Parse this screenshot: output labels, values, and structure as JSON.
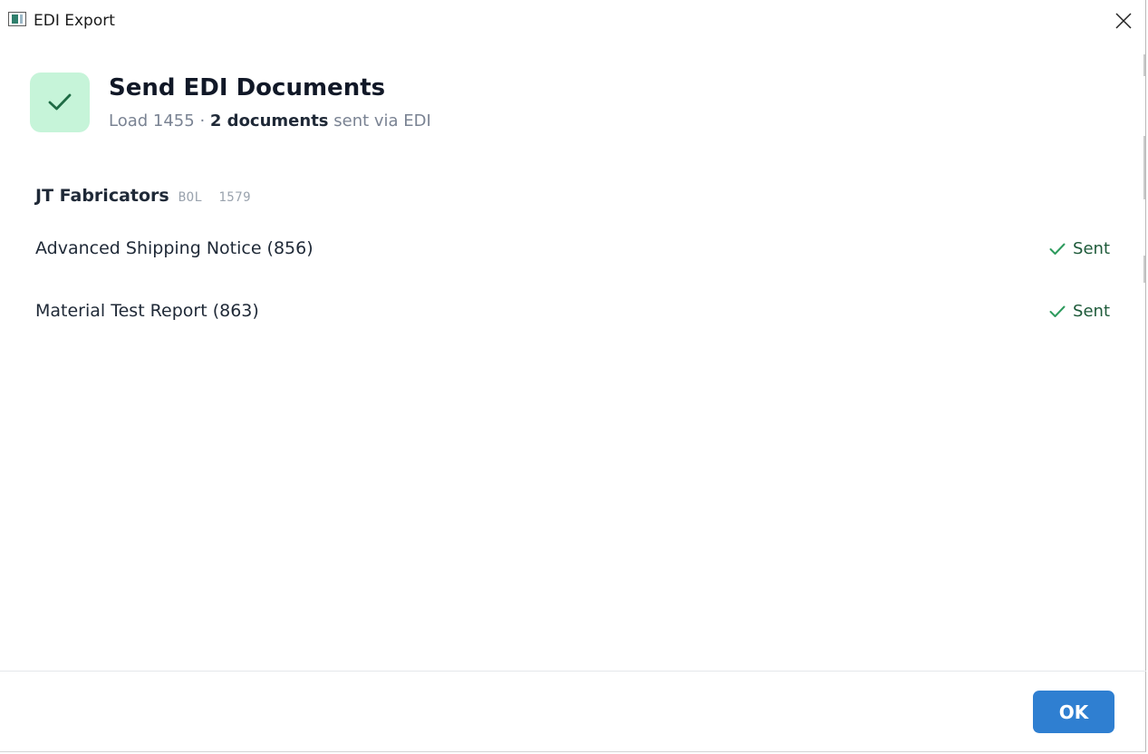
{
  "window": {
    "title": "EDI Export",
    "app_icon": "window-app-icon",
    "close_icon": "close-icon"
  },
  "header": {
    "badge_icon": "checkmark-icon",
    "title": "Send EDI Documents",
    "subtitle": {
      "load": "Load 1455",
      "separator": " · ",
      "count": "2 documents",
      "suffix": " sent via EDI"
    }
  },
  "group": {
    "name": "JT Fabricators",
    "bol": "BOL  1579"
  },
  "documents": [
    {
      "name": "Advanced Shipping Notice (856)",
      "status": "Sent",
      "status_icon": "checkmark-icon"
    },
    {
      "name": "Material Test Report (863)",
      "status": "Sent",
      "status_icon": "checkmark-icon"
    }
  ],
  "footer": {
    "ok_label": "OK"
  },
  "colors": {
    "accent": "#2f7fd1",
    "success_bg": "#c6f4d9",
    "success_fg": "#1e5a3a",
    "success_check": "#2e9b5e",
    "muted_text": "#7a8393"
  }
}
